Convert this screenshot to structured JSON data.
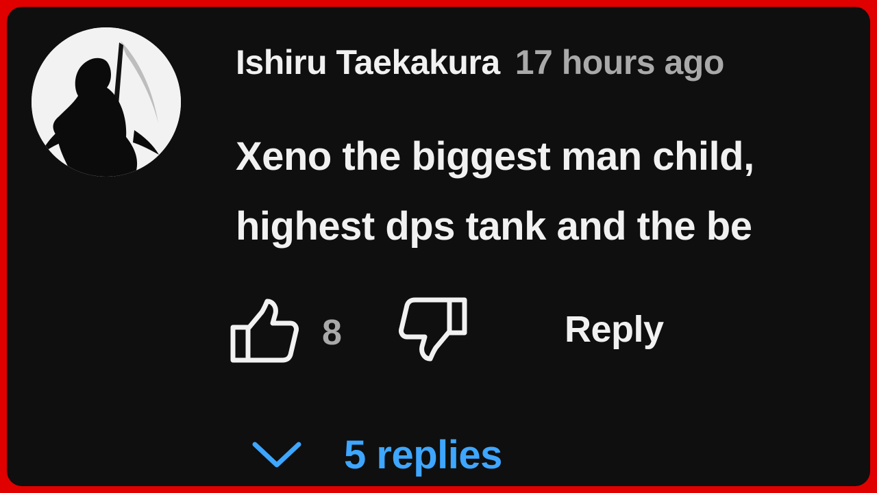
{
  "comment": {
    "author": "Ishiru Taekakura",
    "timestamp": "17 hours ago",
    "text_lines": [
      "Xeno the biggest man child,",
      "highest dps tank and the be"
    ]
  },
  "actions": {
    "like_icon": "thumbs-up-icon",
    "like_count": "8",
    "dislike_icon": "thumbs-down-icon",
    "reply_label": "Reply"
  },
  "replies": {
    "icon": "chevron-down-icon",
    "label": "5 replies",
    "color": "#3ea6ff"
  },
  "colors": {
    "frame_border": "#e00000",
    "background": "#0f0f0f",
    "text_primary": "#f1f1f1",
    "text_secondary": "#a9a9a9"
  }
}
